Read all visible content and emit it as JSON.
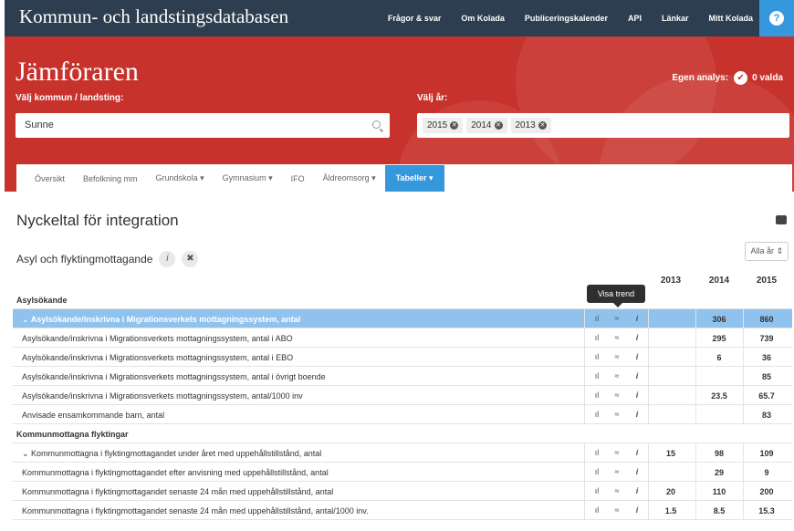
{
  "header": {
    "brand": "Kommun- och landstingsdatabasen",
    "nav": [
      "Frågor & svar",
      "Om Kolada",
      "Publiceringskalender",
      "API",
      "Länkar",
      "Mitt Kolada"
    ],
    "help_icon": "?"
  },
  "hero": {
    "title": "Jämföraren",
    "egen_analys": "Egen analys:",
    "egen_count": "0 valda",
    "kommun_label": "Välj kommun / landsting:",
    "kommun_value": "Sunne",
    "ar_label": "Välj år:",
    "years": [
      "2015",
      "2014",
      "2013"
    ]
  },
  "tabs": [
    "Översikt",
    "Befolkning mm",
    "Grundskola ▾",
    "Gymnasium ▾",
    "IFO",
    "Äldreomsorg ▾",
    "Tabeller ▾"
  ],
  "page": {
    "title": "Nyckeltal för integration",
    "section": "Asyl och flyktingmottagande",
    "info_btn": "i",
    "close_btn": "✖",
    "year_select": "Alla år ⇕",
    "tooltip": "Visa trend"
  },
  "table": {
    "years": [
      "2013",
      "2014",
      "2015"
    ],
    "rows": [
      {
        "type": "group",
        "label": "Asylsökande"
      },
      {
        "type": "data",
        "selected": true,
        "label": "⌄ Asylsökande/inskrivna i Migrationsverkets mottagningssystem, antal",
        "v2013": "",
        "v2014": "306",
        "v2015": "860"
      },
      {
        "type": "data",
        "label": "Asylsökande/inskrivna i Migrationsverkets mottagningssystem, antal i ABO",
        "v2013": "",
        "v2014": "295",
        "v2015": "739"
      },
      {
        "type": "data",
        "label": "Asylsökande/inskrivna i Migrationsverkets mottagningssystem, antal i EBO",
        "v2013": "",
        "v2014": "6",
        "v2015": "36"
      },
      {
        "type": "data",
        "label": "Asylsökande/inskrivna i Migrationsverkets mottagningssystem, antal i övrigt boende",
        "v2013": "",
        "v2014": "",
        "v2015": "85"
      },
      {
        "type": "data",
        "label": "Asylsökande/inskrivna i Migrationsverkets mottagningssystem, antal/1000 inv",
        "v2013": "",
        "v2014": "23.5",
        "v2015": "65.7"
      },
      {
        "type": "data",
        "label": "Anvisade ensamkommande barn, antal",
        "v2013": "",
        "v2014": "",
        "v2015": "83"
      },
      {
        "type": "group",
        "label": "Kommunmottagna flyktingar"
      },
      {
        "type": "data",
        "label": "⌄ Kommunmottagna i flyktingmottagandet under året med uppehållstillstånd, antal",
        "v2013": "15",
        "v2014": "98",
        "v2015": "109"
      },
      {
        "type": "data",
        "label": "Kommunmottagna i flyktingmottagandet efter anvisning med uppehållstillstånd, antal",
        "v2013": "",
        "v2014": "29",
        "v2015": "9"
      },
      {
        "type": "data",
        "label": "Kommunmottagna i flyktingmottagandet senaste 24 mån med uppehållstillstånd, antal",
        "v2013": "20",
        "v2014": "110",
        "v2015": "200"
      },
      {
        "type": "data",
        "label": "Kommunmottagna i flyktingmottagandet senaste 24 mån med uppehållstillstånd, antal/1000 inv.",
        "v2013": "1.5",
        "v2014": "8.5",
        "v2015": "15.3"
      }
    ]
  }
}
